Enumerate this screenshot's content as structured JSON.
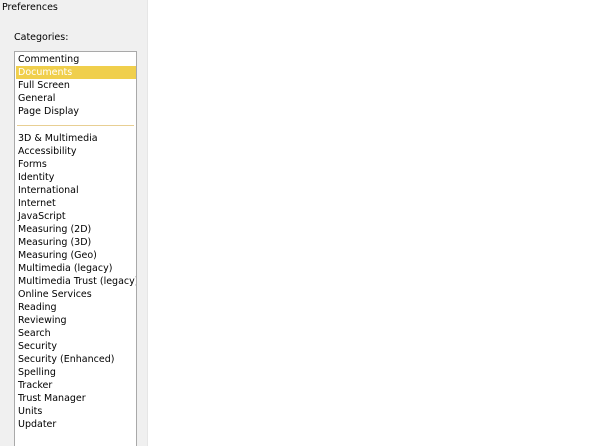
{
  "window": {
    "title": "Preferences"
  },
  "categories": {
    "label": "Categories:",
    "selected_color": "#f0cf4c",
    "top_group": [
      {
        "label": "Commenting",
        "selected": false
      },
      {
        "label": "Documents",
        "selected": true
      },
      {
        "label": "Full Screen",
        "selected": false
      },
      {
        "label": "General",
        "selected": false
      },
      {
        "label": "Page Display",
        "selected": false
      }
    ],
    "bottom_group": [
      {
        "label": "3D & Multimedia",
        "selected": false
      },
      {
        "label": "Accessibility",
        "selected": false
      },
      {
        "label": "Forms",
        "selected": false
      },
      {
        "label": "Identity",
        "selected": false
      },
      {
        "label": "International",
        "selected": false
      },
      {
        "label": "Internet",
        "selected": false
      },
      {
        "label": "JavaScript",
        "selected": false
      },
      {
        "label": "Measuring (2D)",
        "selected": false
      },
      {
        "label": "Measuring (3D)",
        "selected": false
      },
      {
        "label": "Measuring (Geo)",
        "selected": false
      },
      {
        "label": "Multimedia (legacy)",
        "selected": false
      },
      {
        "label": "Multimedia Trust (legacy)",
        "selected": false
      },
      {
        "label": "Online Services",
        "selected": false
      },
      {
        "label": "Reading",
        "selected": false
      },
      {
        "label": "Reviewing",
        "selected": false
      },
      {
        "label": "Search",
        "selected": false
      },
      {
        "label": "Security",
        "selected": false
      },
      {
        "label": "Security (Enhanced)",
        "selected": false
      },
      {
        "label": "Spelling",
        "selected": false
      },
      {
        "label": "Tracker",
        "selected": false
      },
      {
        "label": "Trust Manager",
        "selected": false
      },
      {
        "label": "Units",
        "selected": false
      },
      {
        "label": "Updater",
        "selected": false
      }
    ]
  }
}
